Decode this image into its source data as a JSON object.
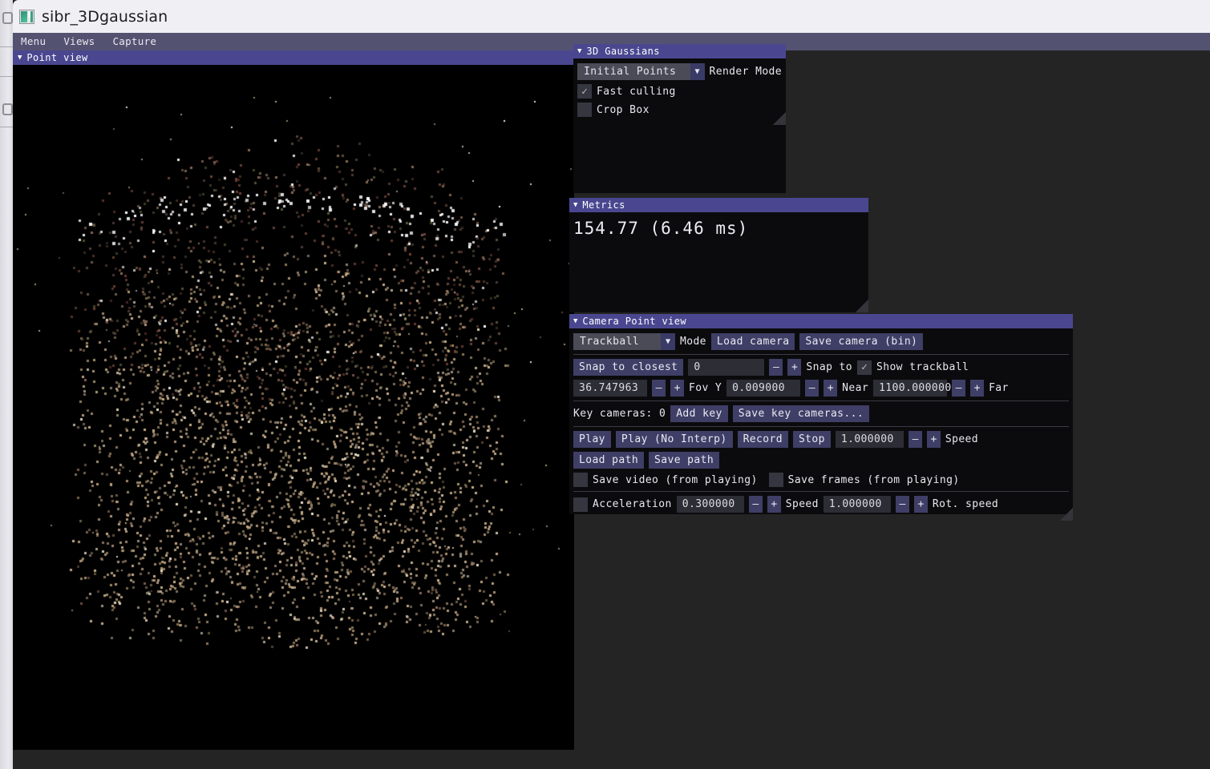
{
  "window": {
    "title": "sibr_3Dgaussian",
    "icon": "app-window-icon"
  },
  "menubar": {
    "items": [
      {
        "label": "Menu"
      },
      {
        "label": "Views"
      },
      {
        "label": "Capture"
      }
    ]
  },
  "viewport": {
    "title": "Point view",
    "collapse_icon": "triangle-down-icon"
  },
  "panels": {
    "gaussians": {
      "title": "3D Gaussians",
      "collapse_icon": "triangle-down-icon",
      "render_mode": {
        "value": "Initial Points",
        "label": "Render Mode",
        "caret_icon": "triangle-down-icon"
      },
      "checkboxes": [
        {
          "label": "Fast culling",
          "checked": true,
          "mark": "✓"
        },
        {
          "label": "Crop Box",
          "checked": false,
          "mark": "✓"
        }
      ]
    },
    "metrics": {
      "title": "Metrics",
      "collapse_icon": "triangle-down-icon",
      "value": "154.77 (6.46 ms)"
    },
    "camera": {
      "title": "Camera Point view",
      "collapse_icon": "triangle-down-icon",
      "mode": {
        "value": "Trackball",
        "label": "Mode",
        "caret_icon": "triangle-down-icon"
      },
      "load_camera_label": "Load camera",
      "save_camera_label": "Save camera (bin)",
      "snap_to_closest_label": "Snap to closest",
      "snap_to_value": "0",
      "snap_to_label": "Snap to",
      "show_trackball": {
        "label": "Show trackball",
        "checked": true,
        "mark": "✓"
      },
      "fov_value": "36.747963",
      "fov_label": "Fov Y",
      "near_value": "0.009000",
      "near_label": "Near",
      "far_value": "1100.000000",
      "far_label": "Far",
      "key_cameras_label": "Key cameras: 0",
      "add_key_label": "Add key",
      "save_key_cameras_label": "Save key cameras...",
      "play_label": "Play",
      "play_no_interp_label": "Play (No Interp)",
      "record_label": "Record",
      "stop_label": "Stop",
      "speed_value": "1.000000",
      "speed_label": "Speed",
      "load_path_label": "Load path",
      "save_path_label": "Save path",
      "save_video": {
        "label": "Save video (from playing)",
        "checked": false,
        "mark": "✓"
      },
      "save_frames": {
        "label": "Save frames (from playing)",
        "checked": false,
        "mark": "✓"
      },
      "acceleration": {
        "label": "Acceleration",
        "checked": false,
        "mark": "✓"
      },
      "acceleration_value": "0.300000",
      "rot_speed_inner_label": "Speed",
      "rot_speed_value": "1.000000",
      "rot_speed_label": "Rot. speed",
      "minus": "–",
      "plus": "+"
    }
  },
  "colors": {
    "title_bar_bg": "#f0f0f4",
    "menu_bar_bg": "#545271",
    "panel_title_bg": "#4a4790",
    "panel_bg": "#0b0b0d",
    "desktop_bg": "#242424",
    "button_bg": "#3e3e66",
    "field_bg": "#2d2d35",
    "viewport_bg": "#000000"
  },
  "point_cloud": {
    "description": "Sparse COLMAP initial point cloud, roughly cylindrical blob",
    "palette": [
      "#c9ae8a",
      "#b49a76",
      "#e8dcc6",
      "#ffffff",
      "#6e4338",
      "#4b3a30",
      "#5c5c3a",
      "#8a6a58"
    ],
    "point_count": 3400
  }
}
